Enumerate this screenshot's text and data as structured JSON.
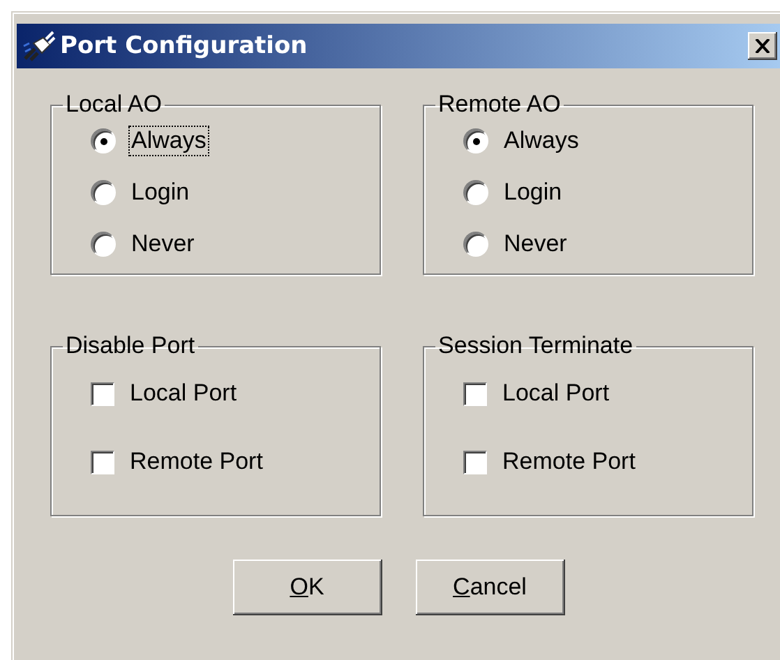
{
  "window": {
    "title": "Port Configuration"
  },
  "radio_groups": [
    {
      "title": "Local AO",
      "options": [
        {
          "label": "Always",
          "selected": true,
          "focused": true
        },
        {
          "label": "Login",
          "selected": false,
          "focused": false
        },
        {
          "label": "Never",
          "selected": false,
          "focused": false
        }
      ]
    },
    {
      "title": "Remote AO",
      "options": [
        {
          "label": "Always",
          "selected": true,
          "focused": false
        },
        {
          "label": "Login",
          "selected": false,
          "focused": false
        },
        {
          "label": "Never",
          "selected": false,
          "focused": false
        }
      ]
    }
  ],
  "check_groups": [
    {
      "title": "Disable Port",
      "options": [
        {
          "label": "Local Port",
          "checked": false
        },
        {
          "label": "Remote Port",
          "checked": false
        }
      ]
    },
    {
      "title": "Session Terminate",
      "options": [
        {
          "label": "Local Port",
          "checked": false
        },
        {
          "label": "Remote Port",
          "checked": false
        }
      ]
    }
  ],
  "buttons": [
    {
      "accel": "O",
      "rest": "K"
    },
    {
      "accel": "C",
      "rest": "ancel"
    }
  ]
}
